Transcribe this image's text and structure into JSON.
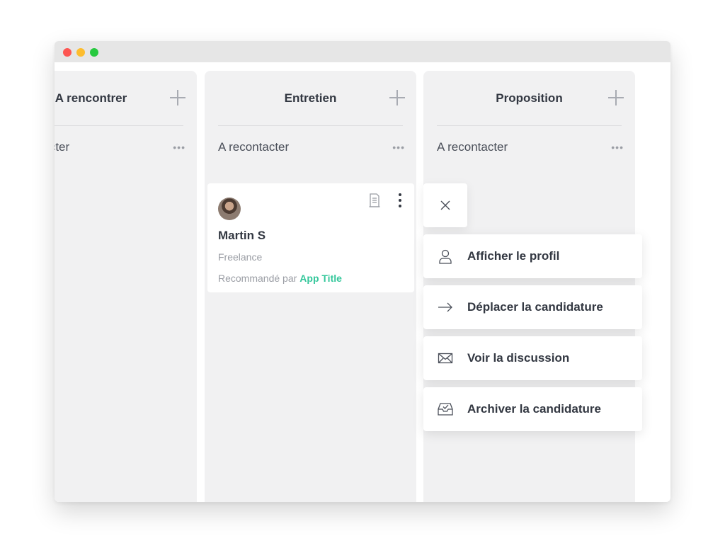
{
  "columns": [
    {
      "title": "A rencontrer",
      "sub_label": "A recontacter",
      "more": "•••"
    },
    {
      "title": "Entretien",
      "sub_label": "A recontacter",
      "more": "•••"
    },
    {
      "title": "Proposition",
      "sub_label": "A recontacter",
      "more": "•••"
    }
  ],
  "card": {
    "name": "Martin S",
    "type": "Freelance",
    "recommended_prefix": "Recommandé par",
    "recommended_by": "App Title"
  },
  "menu": {
    "items": [
      {
        "label": "Afficher le profil",
        "icon": "user-icon"
      },
      {
        "label": "Déplacer la candidature",
        "icon": "arrow-right-icon"
      },
      {
        "label": "Voir la discussion",
        "icon": "envelope-icon"
      },
      {
        "label": "Archiver la candidature",
        "icon": "archive-icon"
      }
    ]
  },
  "colors": {
    "accent": "#34c79b",
    "text": "#333842",
    "column_bg": "#f1f1f2"
  }
}
